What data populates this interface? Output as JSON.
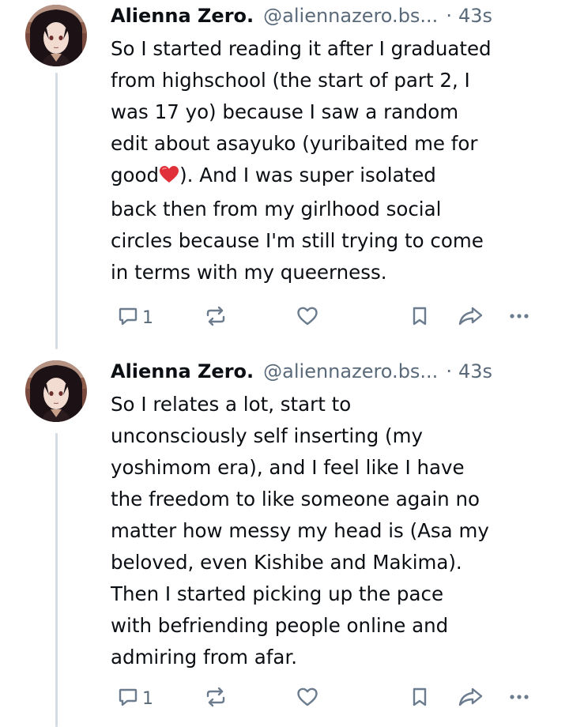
{
  "posts": [
    {
      "author": {
        "name": "Alienna Zero.",
        "handle": "@aliennazero.bs...",
        "separator": "·",
        "time": "43s"
      },
      "lines": [
        "So I started reading it after I graduated",
        "from highschool (the start of part 2, I",
        "was 17 yo) because I saw a random",
        "edit about asayuko (yuribaited me for",
        "good",
        "). And I was super isolated",
        "back then from my girlhood social",
        "circles because I'm still trying to come",
        "in terms with my queerness."
      ],
      "emoji": "red-heart-emoji",
      "actions": {
        "reply_count": "1",
        "reply_icon": "reply-icon",
        "repost_icon": "repost-icon",
        "like_icon": "like-icon",
        "bookmark_icon": "bookmark-icon",
        "share_icon": "share-icon",
        "more_icon": "more-icon"
      }
    },
    {
      "author": {
        "name": "Alienna Zero.",
        "handle": "@aliennazero.bs...",
        "separator": "·",
        "time": "43s"
      },
      "lines": [
        "So I relates a lot, start to",
        "unconsciously self inserting (my",
        "yoshimom era), and I feel like I have",
        "the freedom to like someone again no",
        "matter how messy my head is (Asa my",
        "beloved, even Kishibe and Makima).",
        "Then I started picking up the pace",
        "with befriending people online and",
        "admiring from afar."
      ],
      "actions": {
        "reply_count": "1",
        "reply_icon": "reply-icon",
        "repost_icon": "repost-icon",
        "like_icon": "like-icon",
        "bookmark_icon": "bookmark-icon",
        "share_icon": "share-icon",
        "more_icon": "more-icon"
      }
    }
  ],
  "colors": {
    "text": "#0b0f14",
    "muted": "#5a6a7a",
    "icon": "#6b7c8e",
    "thread_line": "#d4dbe2",
    "heart": "#e0303a"
  }
}
